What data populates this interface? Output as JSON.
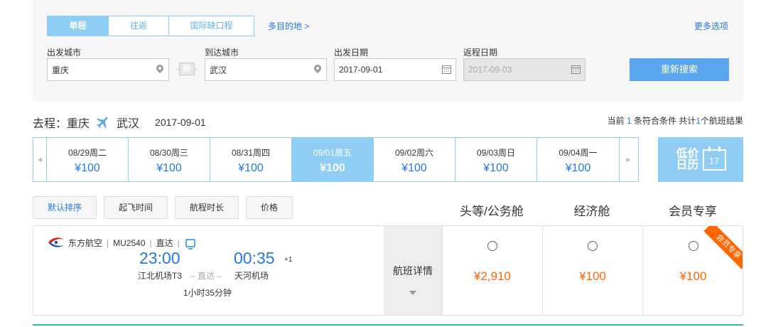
{
  "search": {
    "trip_tabs": [
      {
        "label": "单程",
        "active": true
      },
      {
        "label": "往返",
        "active": false
      },
      {
        "label": "国际缺口程",
        "active": false
      }
    ],
    "multi_dest_link": "多目的地 >",
    "more_options_link": "更多选项",
    "from": {
      "label": "出发城市",
      "value": "重庆"
    },
    "swap_label": "换",
    "to": {
      "label": "到达城市",
      "value": "武汉"
    },
    "depart": {
      "label": "出发日期",
      "value": "2017-09-01"
    },
    "return": {
      "label": "返程日期",
      "value": "2017-09-03"
    },
    "search_button": "重新搜索"
  },
  "route": {
    "prefix": "去程：",
    "from": "重庆",
    "to": "武汉",
    "date": "2017-09-01",
    "result_text_1": "当前 ",
    "result_current": "1",
    "result_text_2": " 条符合条件 共计",
    "result_total": "1",
    "result_text_3": "个航班结果"
  },
  "date_strip": [
    {
      "date": "08/29周二",
      "price": "¥100",
      "active": false
    },
    {
      "date": "08/30周三",
      "price": "¥100",
      "active": false
    },
    {
      "date": "08/31周四",
      "price": "¥100",
      "active": false
    },
    {
      "date": "09/01周五",
      "price": "¥100",
      "active": true
    },
    {
      "date": "09/02周六",
      "price": "¥100",
      "active": false
    },
    {
      "date": "09/03周日",
      "price": "¥100",
      "active": false
    },
    {
      "date": "09/04周一",
      "price": "¥100",
      "active": false
    }
  ],
  "low_calendar": {
    "label": "低价日历",
    "day": "17"
  },
  "sort": {
    "default": "默认排序",
    "departure_time": "起飞时间",
    "duration": "航程时长",
    "price": "价格"
  },
  "cabins": {
    "first": "头等/公务舱",
    "economy": "经济舱",
    "member": "会员专享"
  },
  "flight": {
    "airline": "东方航空",
    "flight_no": "MU2540",
    "type": "直达",
    "dep_time": "23:00",
    "arr_time": "00:35",
    "next_day": "+1",
    "dep_airport": "江北机场T3",
    "arr_airport": "天河机场",
    "direct_mid": "– 直达 –",
    "duration": "1小时35分钟",
    "detail_label": "航班详情",
    "prices": {
      "first": "¥2,910",
      "economy": "¥100",
      "member": "¥100"
    },
    "member_ribbon": "会员专享"
  },
  "colors": {
    "accent_blue": "#8ecdf4",
    "link_blue": "#2577e3",
    "price_orange": "#ff6600",
    "airline_red": "#d7221b"
  }
}
